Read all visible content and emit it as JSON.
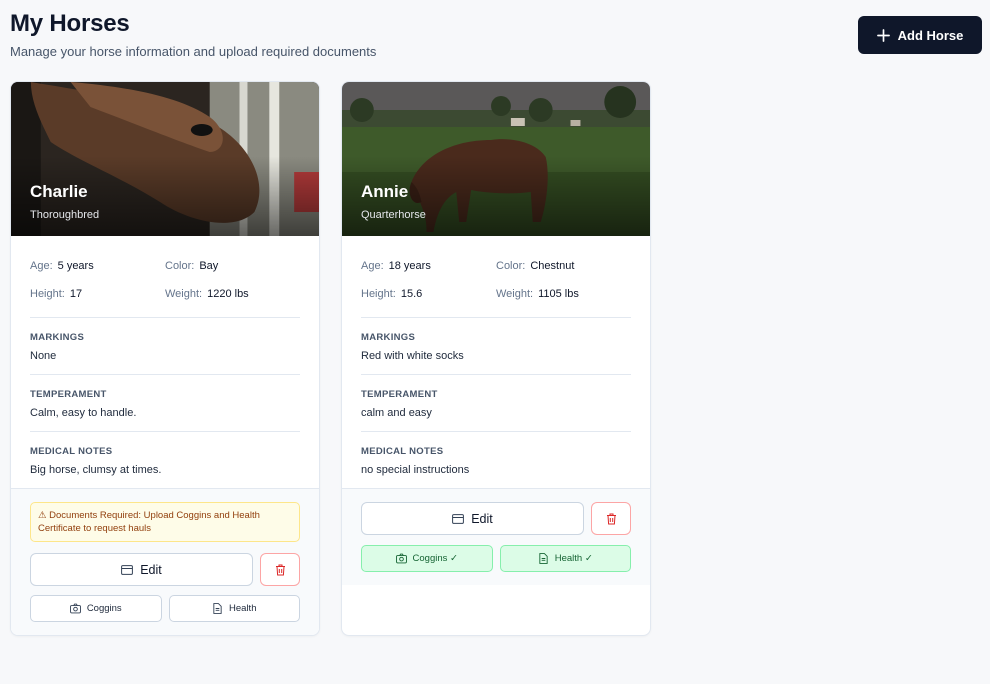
{
  "header": {
    "title": "My Horses",
    "subtitle": "Manage your horse information and upload required documents",
    "add_button_label": "Add Horse"
  },
  "labels": {
    "age": "Age:",
    "color": "Color:",
    "height": "Height:",
    "weight": "Weight:",
    "markings": "MARKINGS",
    "temperament": "TEMPERAMENT",
    "medical_notes": "MEDICAL NOTES",
    "edit": "Edit"
  },
  "horses": [
    {
      "name": "Charlie",
      "breed": "Thoroughbred",
      "age": "5 years",
      "color": "Bay",
      "height": "17",
      "weight": "1220 lbs",
      "markings": "None",
      "temperament": "Calm, easy to handle.",
      "medical_notes": "Big horse, clumsy at times.",
      "warning": "⚠ Documents Required: Upload Coggins and Health Certificate to request hauls",
      "coggins_label": "Coggins",
      "health_label": "Health"
    },
    {
      "name": "Annie",
      "breed": "Quarterhorse",
      "age": "18 years",
      "color": "Chestnut",
      "height": "15.6",
      "weight": "1105 lbs",
      "markings": "Red with white socks",
      "temperament": "calm and easy",
      "medical_notes": "no special instructions",
      "coggins_label": "Coggins ✓",
      "health_label": "Health ✓"
    }
  ],
  "colors": {
    "primary": "#0f172a",
    "warning_bg": "#fefce8",
    "success_bg": "#dcfce7",
    "danger": "#dc2626"
  }
}
